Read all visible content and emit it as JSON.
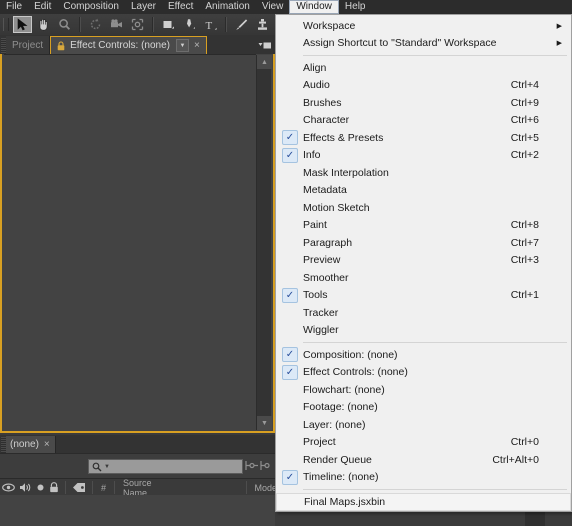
{
  "menubar": {
    "items": [
      {
        "label": "File",
        "active": false
      },
      {
        "label": "Edit",
        "active": false
      },
      {
        "label": "Composition",
        "active": false
      },
      {
        "label": "Layer",
        "active": false
      },
      {
        "label": "Effect",
        "active": false
      },
      {
        "label": "Animation",
        "active": false
      },
      {
        "label": "View",
        "active": false
      },
      {
        "label": "Window",
        "active": true
      },
      {
        "label": "Help",
        "active": false
      }
    ]
  },
  "toolbar": {
    "tools": [
      {
        "name": "selection-tool",
        "selected": true
      },
      {
        "name": "hand-tool",
        "selected": false
      },
      {
        "name": "zoom-tool",
        "selected": false
      },
      {
        "name": "rotation-tool",
        "selected": false
      },
      {
        "name": "camera-tool",
        "selected": false
      },
      {
        "name": "pan-behind-tool",
        "selected": false
      },
      {
        "name": "shape-tool",
        "selected": false
      },
      {
        "name": "pen-tool",
        "selected": false
      },
      {
        "name": "text-tool",
        "selected": false
      },
      {
        "name": "brush-tool",
        "selected": false
      },
      {
        "name": "clone-stamp-tool",
        "selected": false
      },
      {
        "name": "eraser-tool",
        "selected": false
      }
    ]
  },
  "panels": {
    "project_tab": "Project",
    "effect_controls_tab": "Effect Controls: (none)",
    "timeline_tab": "(none)",
    "close_glyph": "×"
  },
  "timeline": {
    "search_placeholder": "",
    "columns": [
      "#",
      "Source Name",
      "Mode"
    ],
    "column_hash": "#",
    "column_source_name": "Source Name",
    "column_mode": "Mode"
  },
  "dropdown": {
    "title": "Window",
    "groups": [
      {
        "items": [
          {
            "label": "Workspace",
            "accel": "",
            "checked": false,
            "submenu": true
          },
          {
            "label": "Assign Shortcut to \"Standard\" Workspace",
            "accel": "",
            "checked": false,
            "submenu": true
          }
        ]
      },
      {
        "items": [
          {
            "label": "Align",
            "accel": "",
            "checked": false,
            "submenu": false
          },
          {
            "label": "Audio",
            "accel": "Ctrl+4",
            "checked": false,
            "submenu": false
          },
          {
            "label": "Brushes",
            "accel": "Ctrl+9",
            "checked": false,
            "submenu": false
          },
          {
            "label": "Character",
            "accel": "Ctrl+6",
            "checked": false,
            "submenu": false
          },
          {
            "label": "Effects & Presets",
            "accel": "Ctrl+5",
            "checked": true,
            "submenu": false
          },
          {
            "label": "Info",
            "accel": "Ctrl+2",
            "checked": true,
            "submenu": false
          },
          {
            "label": "Mask Interpolation",
            "accel": "",
            "checked": false,
            "submenu": false
          },
          {
            "label": "Metadata",
            "accel": "",
            "checked": false,
            "submenu": false
          },
          {
            "label": "Motion Sketch",
            "accel": "",
            "checked": false,
            "submenu": false
          },
          {
            "label": "Paint",
            "accel": "Ctrl+8",
            "checked": false,
            "submenu": false
          },
          {
            "label": "Paragraph",
            "accel": "Ctrl+7",
            "checked": false,
            "submenu": false
          },
          {
            "label": "Preview",
            "accel": "Ctrl+3",
            "checked": false,
            "submenu": false
          },
          {
            "label": "Smoother",
            "accel": "",
            "checked": false,
            "submenu": false
          },
          {
            "label": "Tools",
            "accel": "Ctrl+1",
            "checked": true,
            "submenu": false
          },
          {
            "label": "Tracker",
            "accel": "",
            "checked": false,
            "submenu": false
          },
          {
            "label": "Wiggler",
            "accel": "",
            "checked": false,
            "submenu": false
          }
        ]
      },
      {
        "items": [
          {
            "label": "Composition: (none)",
            "accel": "",
            "checked": true,
            "submenu": false
          },
          {
            "label": "Effect Controls: (none)",
            "accel": "",
            "checked": true,
            "submenu": false
          },
          {
            "label": "Flowchart: (none)",
            "accel": "",
            "checked": false,
            "submenu": false
          },
          {
            "label": "Footage: (none)",
            "accel": "",
            "checked": false,
            "submenu": false
          },
          {
            "label": "Layer: (none)",
            "accel": "",
            "checked": false,
            "submenu": false
          },
          {
            "label": "Project",
            "accel": "Ctrl+0",
            "checked": false,
            "submenu": false
          },
          {
            "label": "Render Queue",
            "accel": "Ctrl+Alt+0",
            "checked": false,
            "submenu": false
          },
          {
            "label": "Timeline: (none)",
            "accel": "",
            "checked": true,
            "submenu": false
          }
        ]
      },
      {
        "items": [
          {
            "label": "Final Maps.jsxbin",
            "accel": "",
            "checked": false,
            "submenu": false,
            "highlight": true
          }
        ]
      }
    ],
    "check_glyph": "✓",
    "submenu_glyph": "▶"
  },
  "colors": {
    "accent_orange": "#d8a022",
    "panel_bg": "#434343",
    "menu_bg": "#f0f0f0",
    "check_blue": "#2a4f9b"
  }
}
